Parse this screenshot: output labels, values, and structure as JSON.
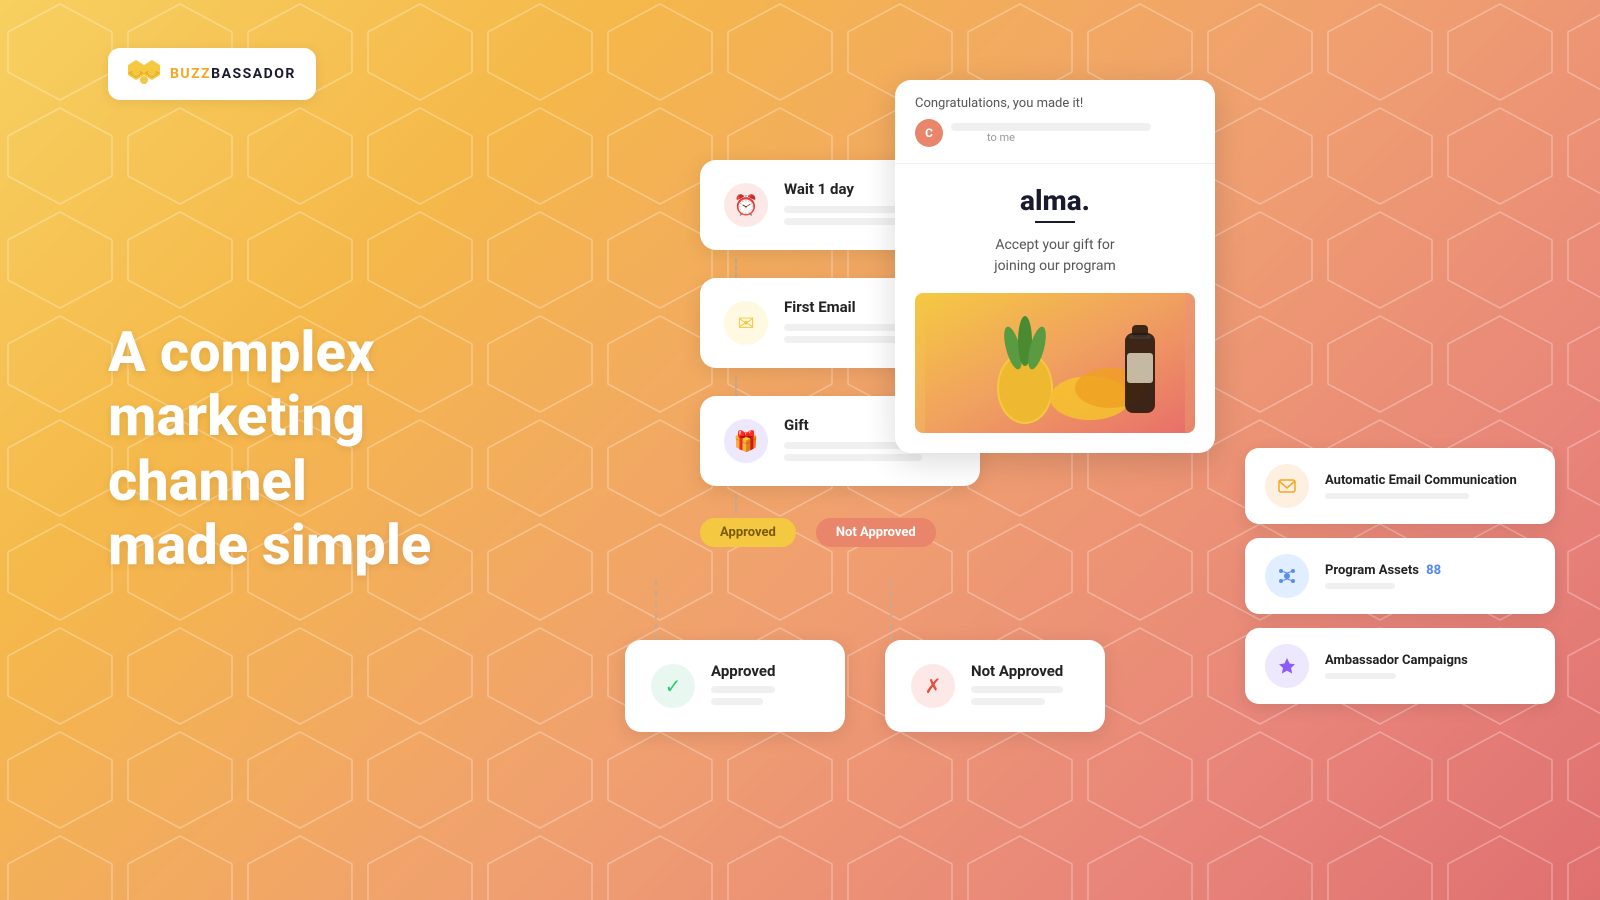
{
  "logo": {
    "text_buzz": "BUZZ",
    "text_bassador": "BASSADOR"
  },
  "hero": {
    "line1": "A complex",
    "line2": "marketing channel",
    "line3": "made simple"
  },
  "workflow": {
    "cards": [
      {
        "id": "wait",
        "title": "Wait 1 day",
        "icon_color": "pink",
        "icon": "⏰"
      },
      {
        "id": "first-email",
        "title": "First Email",
        "icon_color": "yellow",
        "icon": "✉"
      },
      {
        "id": "gift",
        "title": "Gift",
        "icon_color": "purple",
        "icon": "🎁"
      }
    ],
    "branches": {
      "approved_label": "Approved",
      "not_approved_label": "Not Approved"
    },
    "branch_cards": [
      {
        "id": "approved-card",
        "title": "Approved",
        "icon_type": "green",
        "icon": "✓"
      },
      {
        "id": "not-approved-card",
        "title": "Not Approved",
        "icon_type": "red",
        "icon": "✗"
      }
    ]
  },
  "email_preview": {
    "subject": "Congratulations, you made it!",
    "from_initial": "C",
    "to": "to me",
    "brand_name": "alma.",
    "tagline_line1": "Accept your gift for",
    "tagline_line2": "joining our program"
  },
  "feature_cards": [
    {
      "id": "auto-email",
      "icon_type": "orange",
      "icon": "✉",
      "title": "Automatic Email Communication",
      "bar_width": "75%"
    },
    {
      "id": "program-assets",
      "icon_type": "blue",
      "icon": "⚙",
      "title": "Program Assets",
      "badge": "88",
      "bar_width": "60%"
    },
    {
      "id": "ambassador-campaigns",
      "icon_type": "purple",
      "icon": "★",
      "title": "Ambassador Campaigns",
      "bar_width": "50%"
    }
  ],
  "colors": {
    "bg_start": "#f7d060",
    "bg_end": "#e8706a",
    "accent_yellow": "#f5c842",
    "accent_orange": "#e8856a"
  }
}
